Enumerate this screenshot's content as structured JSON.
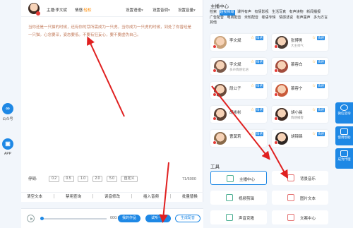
{
  "left_float": {
    "items": [
      {
        "label": "公众号",
        "icon": "infinity-icon"
      },
      {
        "label": "APP",
        "icon": "app-icon"
      }
    ]
  },
  "editor": {
    "anchor_label": "主播:李文斌",
    "mood_prefix": "情感:",
    "mood_value": "轻松",
    "settings": [
      "设置语速",
      "设置音调",
      "设置音量"
    ],
    "body_text": "当你还是一只猫的时候，还有你的芽所需成为一只虎。当你成为一只虎的时候，到处了你曾经是一只猫。心念要深，姿态要低。不要有狂妄心，要不要虚伪自己。",
    "pause_label": "停顿:",
    "pause_options": [
      "0.2",
      "0.5",
      "1.0",
      "2.0",
      "5.0",
      "自定义"
    ],
    "counter": "71/6000",
    "tools": [
      "清空文本",
      "禁用查询",
      "读音修改",
      "插入音频",
      "批量替换"
    ]
  },
  "player": {
    "time": "000:00/00:00",
    "buttons": [
      "我的作品",
      "试听一下",
      "生成配音"
    ]
  },
  "anchor_center": {
    "title": "主播中心",
    "categories": [
      {
        "label": "检索",
        "active": false
      },
      {
        "label": "超视频域",
        "active": true
      },
      {
        "label": "课件有声",
        "active": false
      },
      {
        "label": "有情影视",
        "active": false
      },
      {
        "label": "生活写真",
        "active": false
      },
      {
        "label": "有声读物",
        "active": false
      },
      {
        "label": "新闻播报",
        "active": false
      },
      {
        "label": "广告配音",
        "active": false
      },
      {
        "label": "电商配音",
        "active": false
      },
      {
        "label": "未知配音",
        "active": false
      },
      {
        "label": "卷语专辑",
        "active": false
      },
      {
        "label": "情感述说",
        "active": false
      },
      {
        "label": "有声童声",
        "active": false
      },
      {
        "label": "多为方言",
        "active": false
      },
      {
        "label": "其他",
        "active": false
      }
    ],
    "anchors": [
      {
        "name": "李文斌",
        "desc": "",
        "tag": "情感",
        "star": "☆",
        "color": "#c9a27a"
      },
      {
        "name": "张博男",
        "desc": "大主帅气",
        "tag": "情感",
        "star": "☆",
        "color": "#4a3b33"
      },
      {
        "name": "宇文斌",
        "desc": "多声情感化语",
        "tag": "情感",
        "star": "☆",
        "color": "#7b5a4a"
      },
      {
        "name": "慕容白",
        "desc": "",
        "tag": "情感",
        "star": "☆",
        "color": "#a44d3d"
      },
      {
        "name": "段公子",
        "desc": "",
        "tag": "情感",
        "star": "☆",
        "color": "#6a4a3a"
      },
      {
        "name": "慕容宁",
        "desc": "",
        "tag": "情感",
        "star": "☆",
        "color": "#c95a3a"
      },
      {
        "name": "胡彬彬",
        "desc": "",
        "tag": "情感",
        "star": "☆",
        "color": "#5a4033"
      },
      {
        "name": "胡小晨",
        "desc": "情感播客",
        "tag": "情感",
        "star": "☆",
        "color": "#3d2a22"
      },
      {
        "name": "曹莫莉",
        "desc": "",
        "tag": "情感",
        "star": "☆",
        "color": "#8a6a4a"
      },
      {
        "name": "胡锦锦",
        "desc": "",
        "tag": "情感",
        "star": "☆",
        "color": "#2e2622"
      }
    ],
    "tools_title": "工具",
    "tools": [
      {
        "label": "主播中心",
        "icon": "music-note-icon",
        "color": "#4caf92",
        "selected": true
      },
      {
        "label": "背景音乐",
        "icon": "music-note-icon",
        "color": "#e57373",
        "selected": false
      },
      {
        "label": "视频剪辑",
        "icon": "film-icon",
        "color": "#4caf92",
        "selected": false
      },
      {
        "label": "图片文本",
        "icon": "calendar-icon",
        "color": "#e57373",
        "selected": false
      },
      {
        "label": "声音克隆",
        "icon": "grid-icon",
        "color": "#4caf92",
        "selected": false
      },
      {
        "label": "文案中心",
        "icon": "document-icon",
        "color": "#e57373",
        "selected": false
      }
    ]
  },
  "right_float": {
    "items": [
      "微信咨询",
      "使用帮助",
      "成为代理"
    ]
  }
}
